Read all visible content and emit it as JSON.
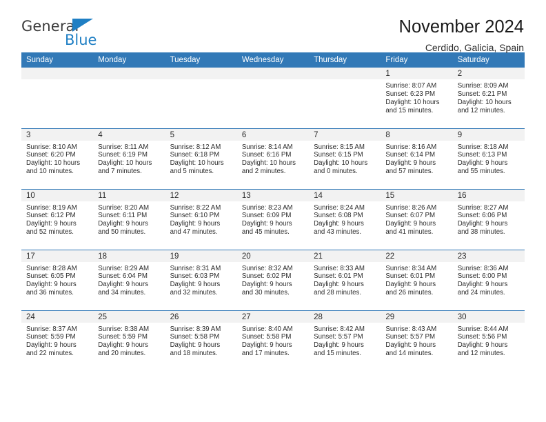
{
  "logo": {
    "primary_text": "General",
    "secondary_text": "Blue",
    "triangle_color": "#1f7fc4",
    "primary_color": "#3c3c3c"
  },
  "header": {
    "title": "November 2024",
    "subtitle": "Cerdido, Galicia, Spain"
  },
  "theme": {
    "header_blue": "#3279b7",
    "day_strip_gray": "#f2f2f2",
    "text": "#2b2b2b"
  },
  "calendar": {
    "weekday_headers": [
      "Sunday",
      "Monday",
      "Tuesday",
      "Wednesday",
      "Thursday",
      "Friday",
      "Saturday"
    ],
    "weeks": [
      [
        {
          "day": "",
          "sunrise": "",
          "sunset": "",
          "daylight_line1": "",
          "daylight_line2": ""
        },
        {
          "day": "",
          "sunrise": "",
          "sunset": "",
          "daylight_line1": "",
          "daylight_line2": ""
        },
        {
          "day": "",
          "sunrise": "",
          "sunset": "",
          "daylight_line1": "",
          "daylight_line2": ""
        },
        {
          "day": "",
          "sunrise": "",
          "sunset": "",
          "daylight_line1": "",
          "daylight_line2": ""
        },
        {
          "day": "",
          "sunrise": "",
          "sunset": "",
          "daylight_line1": "",
          "daylight_line2": ""
        },
        {
          "day": "1",
          "sunrise": "Sunrise: 8:07 AM",
          "sunset": "Sunset: 6:23 PM",
          "daylight_line1": "Daylight: 10 hours",
          "daylight_line2": "and 15 minutes."
        },
        {
          "day": "2",
          "sunrise": "Sunrise: 8:09 AM",
          "sunset": "Sunset: 6:21 PM",
          "daylight_line1": "Daylight: 10 hours",
          "daylight_line2": "and 12 minutes."
        }
      ],
      [
        {
          "day": "3",
          "sunrise": "Sunrise: 8:10 AM",
          "sunset": "Sunset: 6:20 PM",
          "daylight_line1": "Daylight: 10 hours",
          "daylight_line2": "and 10 minutes."
        },
        {
          "day": "4",
          "sunrise": "Sunrise: 8:11 AM",
          "sunset": "Sunset: 6:19 PM",
          "daylight_line1": "Daylight: 10 hours",
          "daylight_line2": "and 7 minutes."
        },
        {
          "day": "5",
          "sunrise": "Sunrise: 8:12 AM",
          "sunset": "Sunset: 6:18 PM",
          "daylight_line1": "Daylight: 10 hours",
          "daylight_line2": "and 5 minutes."
        },
        {
          "day": "6",
          "sunrise": "Sunrise: 8:14 AM",
          "sunset": "Sunset: 6:16 PM",
          "daylight_line1": "Daylight: 10 hours",
          "daylight_line2": "and 2 minutes."
        },
        {
          "day": "7",
          "sunrise": "Sunrise: 8:15 AM",
          "sunset": "Sunset: 6:15 PM",
          "daylight_line1": "Daylight: 10 hours",
          "daylight_line2": "and 0 minutes."
        },
        {
          "day": "8",
          "sunrise": "Sunrise: 8:16 AM",
          "sunset": "Sunset: 6:14 PM",
          "daylight_line1": "Daylight: 9 hours",
          "daylight_line2": "and 57 minutes."
        },
        {
          "day": "9",
          "sunrise": "Sunrise: 8:18 AM",
          "sunset": "Sunset: 6:13 PM",
          "daylight_line1": "Daylight: 9 hours",
          "daylight_line2": "and 55 minutes."
        }
      ],
      [
        {
          "day": "10",
          "sunrise": "Sunrise: 8:19 AM",
          "sunset": "Sunset: 6:12 PM",
          "daylight_line1": "Daylight: 9 hours",
          "daylight_line2": "and 52 minutes."
        },
        {
          "day": "11",
          "sunrise": "Sunrise: 8:20 AM",
          "sunset": "Sunset: 6:11 PM",
          "daylight_line1": "Daylight: 9 hours",
          "daylight_line2": "and 50 minutes."
        },
        {
          "day": "12",
          "sunrise": "Sunrise: 8:22 AM",
          "sunset": "Sunset: 6:10 PM",
          "daylight_line1": "Daylight: 9 hours",
          "daylight_line2": "and 47 minutes."
        },
        {
          "day": "13",
          "sunrise": "Sunrise: 8:23 AM",
          "sunset": "Sunset: 6:09 PM",
          "daylight_line1": "Daylight: 9 hours",
          "daylight_line2": "and 45 minutes."
        },
        {
          "day": "14",
          "sunrise": "Sunrise: 8:24 AM",
          "sunset": "Sunset: 6:08 PM",
          "daylight_line1": "Daylight: 9 hours",
          "daylight_line2": "and 43 minutes."
        },
        {
          "day": "15",
          "sunrise": "Sunrise: 8:26 AM",
          "sunset": "Sunset: 6:07 PM",
          "daylight_line1": "Daylight: 9 hours",
          "daylight_line2": "and 41 minutes."
        },
        {
          "day": "16",
          "sunrise": "Sunrise: 8:27 AM",
          "sunset": "Sunset: 6:06 PM",
          "daylight_line1": "Daylight: 9 hours",
          "daylight_line2": "and 38 minutes."
        }
      ],
      [
        {
          "day": "17",
          "sunrise": "Sunrise: 8:28 AM",
          "sunset": "Sunset: 6:05 PM",
          "daylight_line1": "Daylight: 9 hours",
          "daylight_line2": "and 36 minutes."
        },
        {
          "day": "18",
          "sunrise": "Sunrise: 8:29 AM",
          "sunset": "Sunset: 6:04 PM",
          "daylight_line1": "Daylight: 9 hours",
          "daylight_line2": "and 34 minutes."
        },
        {
          "day": "19",
          "sunrise": "Sunrise: 8:31 AM",
          "sunset": "Sunset: 6:03 PM",
          "daylight_line1": "Daylight: 9 hours",
          "daylight_line2": "and 32 minutes."
        },
        {
          "day": "20",
          "sunrise": "Sunrise: 8:32 AM",
          "sunset": "Sunset: 6:02 PM",
          "daylight_line1": "Daylight: 9 hours",
          "daylight_line2": "and 30 minutes."
        },
        {
          "day": "21",
          "sunrise": "Sunrise: 8:33 AM",
          "sunset": "Sunset: 6:01 PM",
          "daylight_line1": "Daylight: 9 hours",
          "daylight_line2": "and 28 minutes."
        },
        {
          "day": "22",
          "sunrise": "Sunrise: 8:34 AM",
          "sunset": "Sunset: 6:01 PM",
          "daylight_line1": "Daylight: 9 hours",
          "daylight_line2": "and 26 minutes."
        },
        {
          "day": "23",
          "sunrise": "Sunrise: 8:36 AM",
          "sunset": "Sunset: 6:00 PM",
          "daylight_line1": "Daylight: 9 hours",
          "daylight_line2": "and 24 minutes."
        }
      ],
      [
        {
          "day": "24",
          "sunrise": "Sunrise: 8:37 AM",
          "sunset": "Sunset: 5:59 PM",
          "daylight_line1": "Daylight: 9 hours",
          "daylight_line2": "and 22 minutes."
        },
        {
          "day": "25",
          "sunrise": "Sunrise: 8:38 AM",
          "sunset": "Sunset: 5:59 PM",
          "daylight_line1": "Daylight: 9 hours",
          "daylight_line2": "and 20 minutes."
        },
        {
          "day": "26",
          "sunrise": "Sunrise: 8:39 AM",
          "sunset": "Sunset: 5:58 PM",
          "daylight_line1": "Daylight: 9 hours",
          "daylight_line2": "and 18 minutes."
        },
        {
          "day": "27",
          "sunrise": "Sunrise: 8:40 AM",
          "sunset": "Sunset: 5:58 PM",
          "daylight_line1": "Daylight: 9 hours",
          "daylight_line2": "and 17 minutes."
        },
        {
          "day": "28",
          "sunrise": "Sunrise: 8:42 AM",
          "sunset": "Sunset: 5:57 PM",
          "daylight_line1": "Daylight: 9 hours",
          "daylight_line2": "and 15 minutes."
        },
        {
          "day": "29",
          "sunrise": "Sunrise: 8:43 AM",
          "sunset": "Sunset: 5:57 PM",
          "daylight_line1": "Daylight: 9 hours",
          "daylight_line2": "and 14 minutes."
        },
        {
          "day": "30",
          "sunrise": "Sunrise: 8:44 AM",
          "sunset": "Sunset: 5:56 PM",
          "daylight_line1": "Daylight: 9 hours",
          "daylight_line2": "and 12 minutes."
        }
      ]
    ]
  }
}
